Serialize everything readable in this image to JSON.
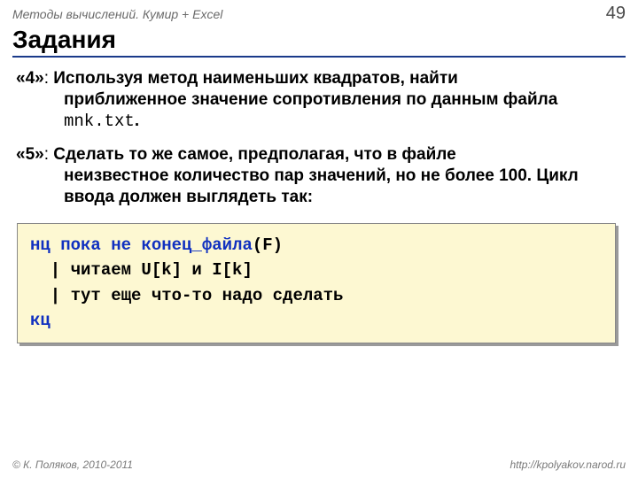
{
  "header": {
    "title": "Методы вычислений. Кумир + Excel",
    "page": "49"
  },
  "title": "Задания",
  "task4": {
    "badge": "«4»",
    "sep": ": ",
    "l1": "Используя метод наименьших квадратов, найти",
    "l2a": "приближенное значение сопротивления по данным файла ",
    "file": "mnk.txt",
    "dot": "."
  },
  "task5": {
    "badge": "«5»",
    "sep": ": ",
    "l1": "Сделать то же самое, предполагая, что в файле",
    "l2": "неизвестное количество пар значений, но не более 100. Цикл ввода должен выглядеть так:"
  },
  "code": {
    "kw_nc": "нц",
    "kw_poka": " пока ",
    "kw_ne": "не",
    "sp": " ",
    "fn": "конец_файла",
    "arg": "(F)",
    "c1": "  | читаем U[k] и I[k]",
    "c2": "  | тут еще что-то надо сделать",
    "kw_kc": "кц"
  },
  "footer": {
    "left": "© К. Поляков, 2010-2011",
    "right": "http://kpolyakov.narod.ru"
  }
}
